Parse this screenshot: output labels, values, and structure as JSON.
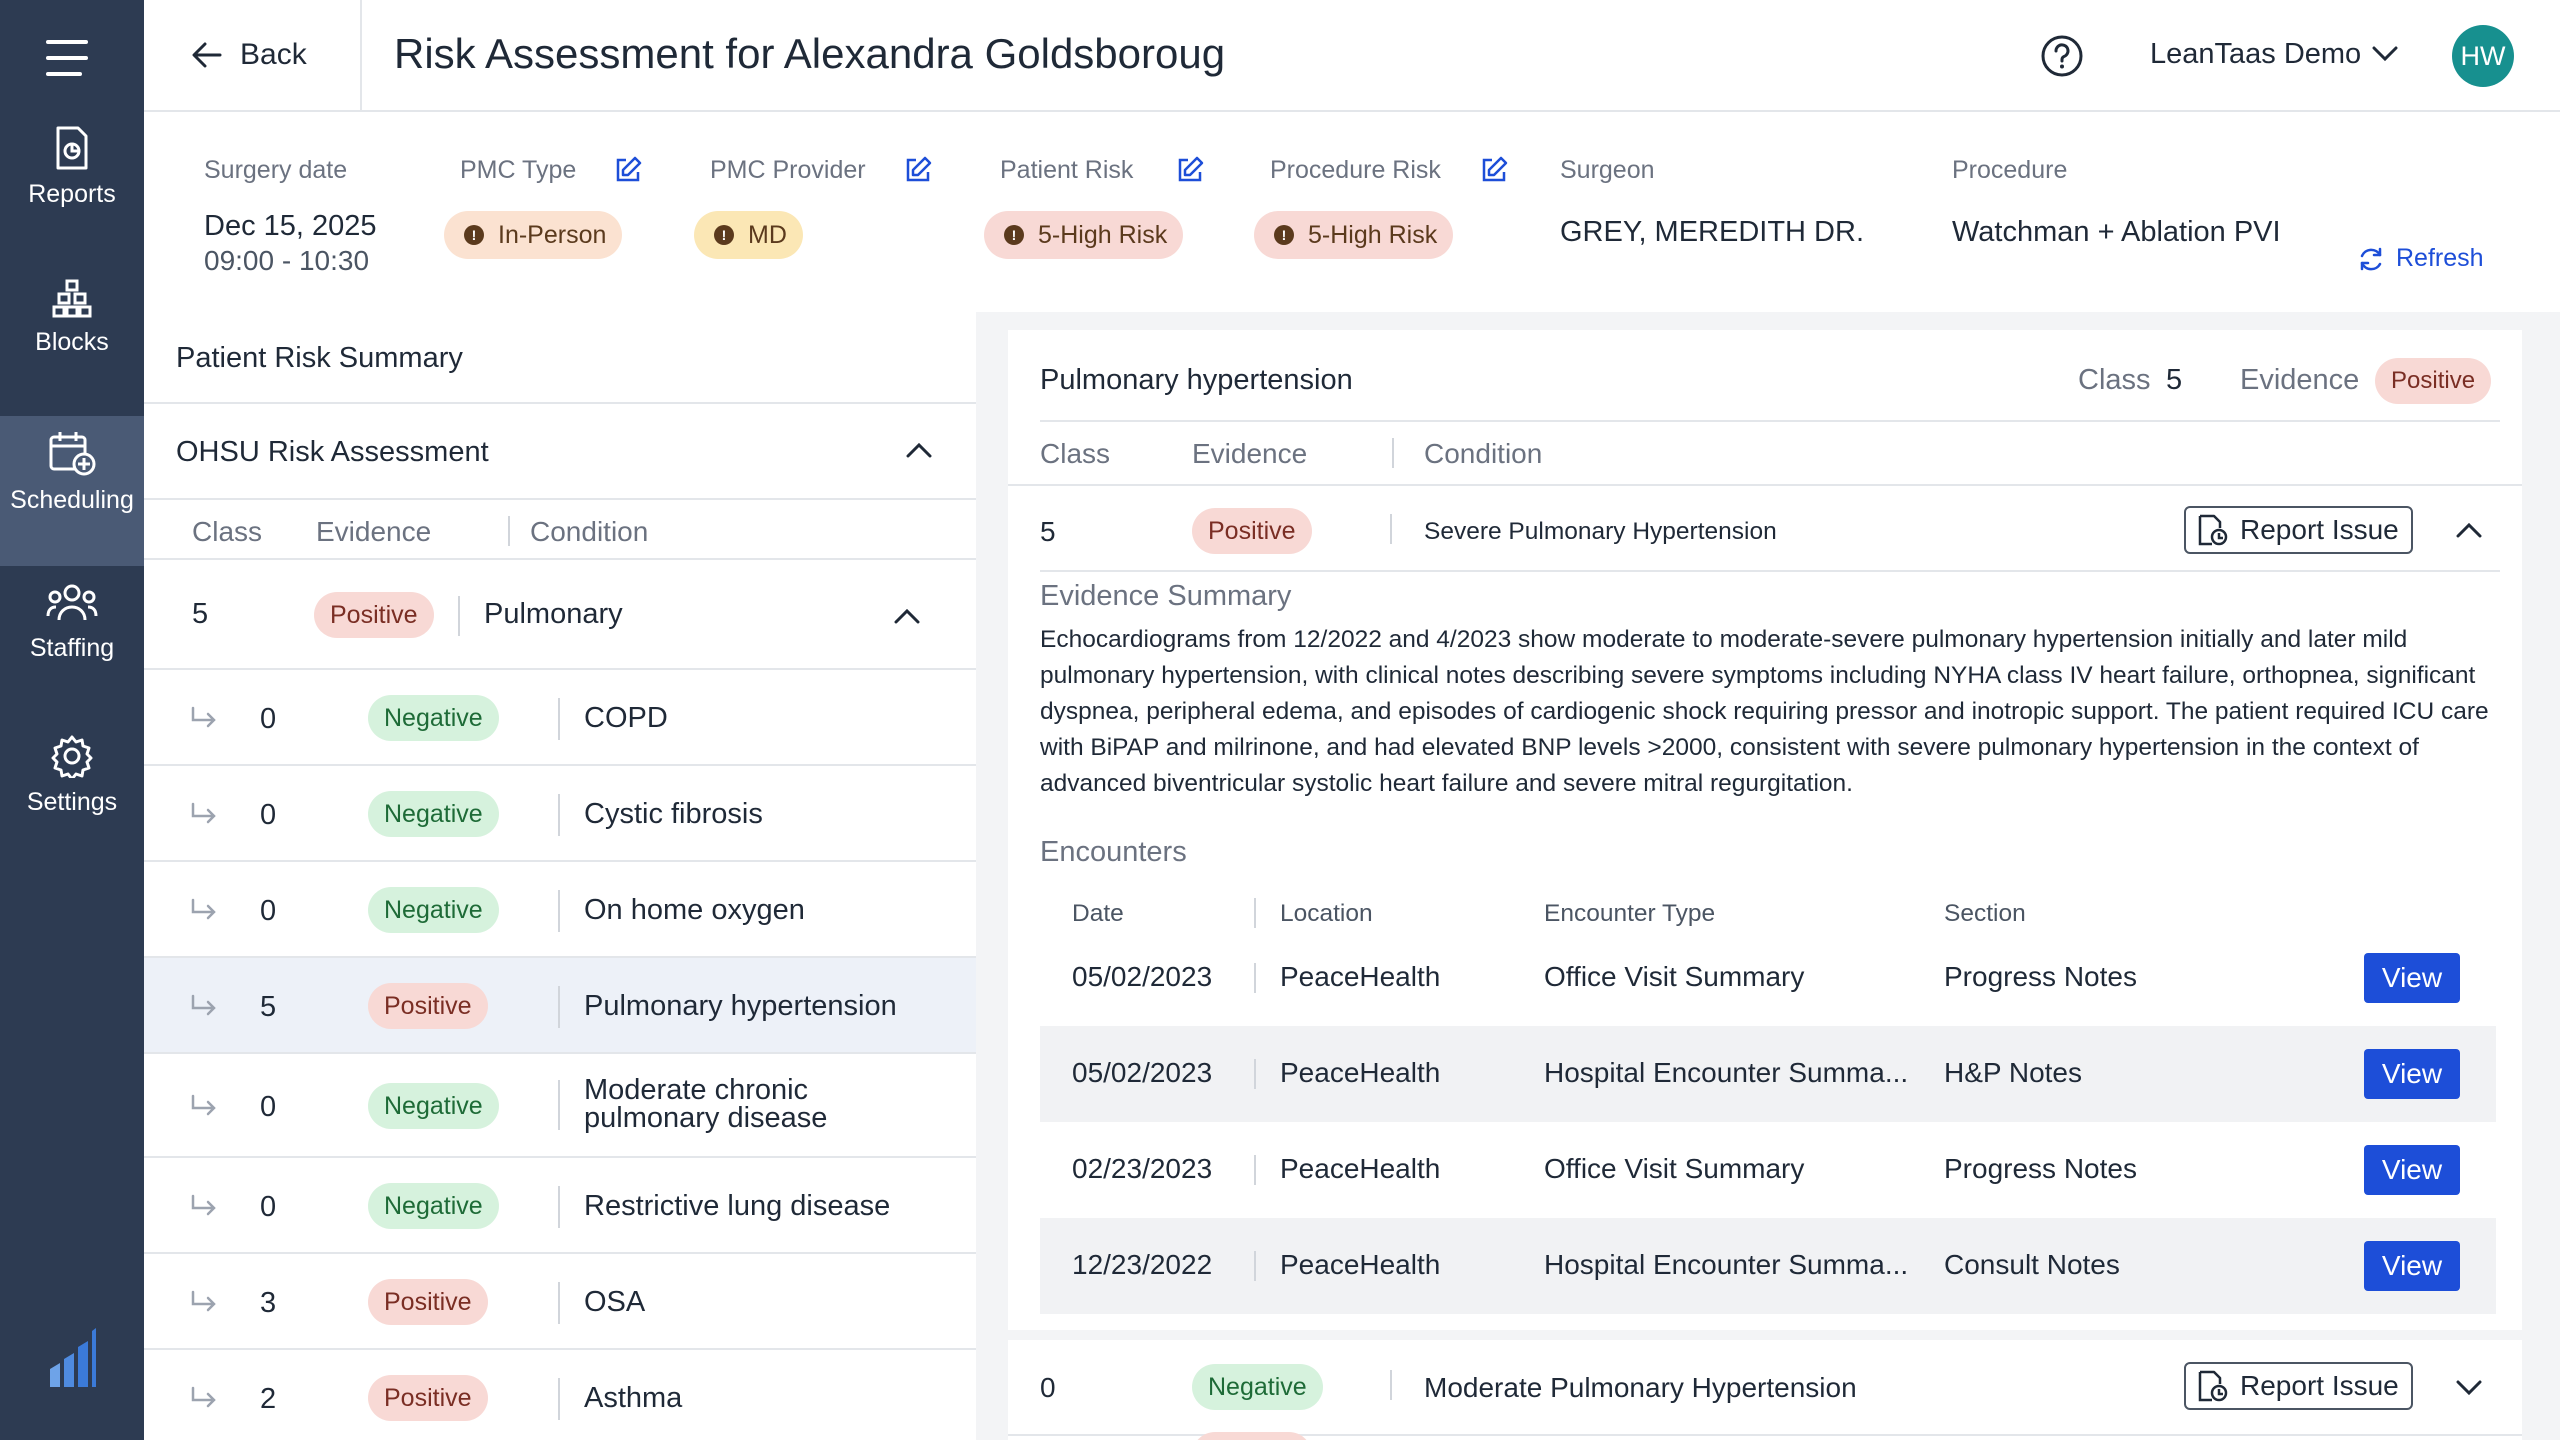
{
  "sidebar": {
    "items": [
      {
        "label": "Reports",
        "icon": "report-icon"
      },
      {
        "label": "Blocks",
        "icon": "blocks-icon"
      },
      {
        "label": "Scheduling",
        "icon": "calendar-add-icon"
      },
      {
        "label": "Staffing",
        "icon": "people-icon"
      },
      {
        "label": "Settings",
        "icon": "gear-icon"
      }
    ],
    "active": "Scheduling"
  },
  "header": {
    "back_label": "Back",
    "title": "Risk Assessment for Alexandra Goldsboroug",
    "account_name": "LeanTaas Demo",
    "avatar_initials": "HW"
  },
  "info": {
    "surgery_date_label": "Surgery date",
    "surgery_date": "Dec 15, 2025",
    "surgery_time": "09:00 - 10:30",
    "pmc_type_label": "PMC Type",
    "pmc_type": "In-Person",
    "pmc_provider_label": "PMC Provider",
    "pmc_provider": "MD",
    "patient_risk_label": "Patient Risk",
    "patient_risk": "5-High Risk",
    "procedure_risk_label": "Procedure Risk",
    "procedure_risk": "5-High Risk",
    "surgeon_label": "Surgeon",
    "surgeon": "GREY, MEREDITH DR.",
    "procedure_label": "Procedure",
    "procedure": "Watchman + Ablation PVI",
    "refresh_label": "Refresh"
  },
  "left": {
    "summary_title": "Patient Risk Summary",
    "section_title": "OHSU Risk Assessment",
    "col_class": "Class",
    "col_evidence": "Evidence",
    "col_condition": "Condition",
    "parent_row": {
      "class": "5",
      "evidence": "Positive",
      "condition": "Pulmonary"
    },
    "rows": [
      {
        "class": "0",
        "evidence": "Negative",
        "condition": "COPD"
      },
      {
        "class": "0",
        "evidence": "Negative",
        "condition": "Cystic fibrosis"
      },
      {
        "class": "0",
        "evidence": "Negative",
        "condition": "On home oxygen"
      },
      {
        "class": "5",
        "evidence": "Positive",
        "condition": "Pulmonary hypertension"
      },
      {
        "class": "0",
        "evidence": "Negative",
        "condition_line1": "Moderate chronic",
        "condition_line2": "pulmonary disease"
      },
      {
        "class": "0",
        "evidence": "Negative",
        "condition": "Restrictive lung disease"
      },
      {
        "class": "3",
        "evidence": "Positive",
        "condition": "OSA"
      },
      {
        "class": "2",
        "evidence": "Positive",
        "condition": "Asthma"
      }
    ]
  },
  "detail": {
    "title": "Pulmonary hypertension",
    "class_label": "Class",
    "class_value": "5",
    "evidence_label": "Evidence",
    "evidence_value": "Positive",
    "col_class": "Class",
    "col_evidence": "Evidence",
    "col_condition": "Condition",
    "item1": {
      "class": "5",
      "evidence": "Positive",
      "condition": "Severe Pulmonary Hypertension"
    },
    "report_label": "Report Issue",
    "evidence_summary_label": "Evidence Summary",
    "evidence_summary": "Echocardiograms from 12/2022 and 4/2023 show moderate to moderate-severe pulmonary hypertension initially and later mild pulmonary hypertension, with clinical notes describing severe symptoms including NYHA class IV heart failure, orthopnea, significant dyspnea, peripheral edema, and episodes of cardiogenic shock requiring pressor and inotropic support. The patient required ICU care with BiPAP and milrinone, and had elevated BNP levels >2000, consistent with severe pulmonary hypertension in the context of advanced biventricular systolic heart failure and severe mitral regurgitation.",
    "encounters_label": "Encounters",
    "enc_headers": {
      "date": "Date",
      "location": "Location",
      "type": "Encounter Type",
      "section": "Section"
    },
    "encounters": [
      {
        "date": "05/02/2023",
        "location": "PeaceHealth",
        "type": "Office Visit Summary",
        "section": "Progress Notes",
        "action": "View"
      },
      {
        "date": "05/02/2023",
        "location": "PeaceHealth",
        "type": "Hospital Encounter Summa...",
        "section": "H&P Notes",
        "action": "View"
      },
      {
        "date": "02/23/2023",
        "location": "PeaceHealth",
        "type": "Office Visit Summary",
        "section": "Progress Notes",
        "action": "View"
      },
      {
        "date": "12/23/2022",
        "location": "PeaceHealth",
        "type": "Hospital Encounter Summa...",
        "section": "Consult Notes",
        "action": "View"
      }
    ],
    "item2": {
      "class": "0",
      "evidence": "Negative",
      "condition": "Moderate Pulmonary Hypertension"
    }
  },
  "colors": {
    "sidebar_bg": "#2d3b52",
    "sidebar_active": "#4a5a75",
    "accent_blue": "#1d4ed8",
    "avatar_teal": "#17908f",
    "positive_bg": "#f8d9d5",
    "negative_bg": "#d6f2dd"
  }
}
